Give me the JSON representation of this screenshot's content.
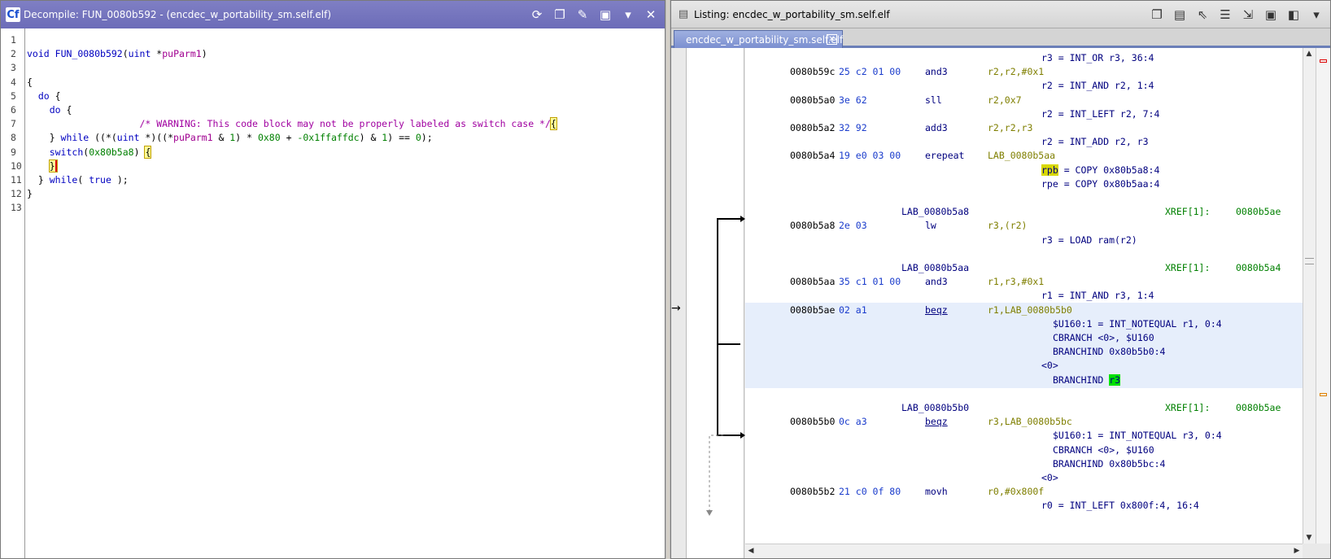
{
  "decompiler": {
    "app_icon": "Cf",
    "title": "Decompile: FUN_0080b592 -  (encdec_w_portability_sm.self.elf)",
    "icons": [
      "refresh-icon",
      "copy-icon",
      "edit-icon",
      "snapshot-icon",
      "menu-chevron-icon",
      "close-icon"
    ],
    "icon_glyphs": [
      "⟳",
      "❐",
      "✎",
      "▣",
      "▾",
      "✕"
    ],
    "lines": [
      {
        "n": "1",
        "code": ""
      },
      {
        "n": "2",
        "code": "void FUN_0080b592(uint *puParm1)"
      },
      {
        "n": "3",
        "code": ""
      },
      {
        "n": "4",
        "code": "{"
      },
      {
        "n": "5",
        "code": "  do {"
      },
      {
        "n": "6",
        "code": "    do {"
      },
      {
        "n": "7",
        "code": "                    /* WARNING: This code block may not be properly labeled as switch case */"
      },
      {
        "n": "8",
        "code": "    } while ((*(uint *)((*puParm1 & 1) * 0x80 + -0x1ffaffdc) & 1) == 0);"
      },
      {
        "n": "9",
        "code": "    switch(0x80b5a8) {"
      },
      {
        "n": "10",
        "code": "    }"
      },
      {
        "n": "11",
        "code": "  } while( true );"
      },
      {
        "n": "12",
        "code": "}"
      },
      {
        "n": "13",
        "code": ""
      }
    ]
  },
  "listing": {
    "title": "Listing: encdec_w_portability_sm.self.elf",
    "tab_label": "encdec_w_portability_sm.self.elf",
    "tab_close": "✕",
    "icons": [
      "copy-icon",
      "paste-icon",
      "select-cursor-icon",
      "columns-icon",
      "navigate-icon",
      "snapshot-icon",
      "layout-icon",
      "menu-chevron-icon"
    ],
    "icon_glyphs": [
      "❐",
      "▤",
      "⇖",
      "☰",
      "⇲",
      "▣",
      "◧",
      "▾"
    ],
    "rows": [
      {
        "pcode": "r3 = INT_OR r3, 36:4",
        "pcx": 364
      },
      {
        "addr": "0080b59c",
        "bytes": "25 c2 01 00",
        "mn": "and3",
        "ops": "r2,r2,#0x1"
      },
      {
        "pcode": "r2 = INT_AND r2, 1:4",
        "pcx": 364
      },
      {
        "addr": "0080b5a0",
        "bytes": "3e 62",
        "mn": "sll",
        "ops": "r2,0x7"
      },
      {
        "pcode": "r2 = INT_LEFT r2, 7:4",
        "pcx": 364
      },
      {
        "addr": "0080b5a2",
        "bytes": "32 92",
        "mn": "add3",
        "ops": "r2,r2,r3"
      },
      {
        "pcode": "r2 = INT_ADD r2, r3",
        "pcx": 364
      },
      {
        "addr": "0080b5a4",
        "bytes": "19 e0 03 00",
        "mn": "erepeat",
        "ops": "LAB_0080b5aa"
      },
      {
        "pcode": "rpb = COPY 0x80b5a8:4",
        "pcx": 364
      },
      {
        "pcode": "rpe = COPY 0x80b5aa:4",
        "pcx": 364
      },
      {},
      {
        "label": "LAB_0080b5a8",
        "xref": "XREF[1]:",
        "xaddr": "0080b5ae"
      },
      {
        "addr": "0080b5a8",
        "bytes": "2e 03",
        "mn": "lw",
        "ops": "r3,(r2)"
      },
      {
        "pcode": "r3 = LOAD ram(r2)",
        "pcx": 364
      },
      {},
      {
        "label": "LAB_0080b5aa",
        "xref": "XREF[1]:",
        "xaddr": "0080b5a4"
      },
      {
        "addr": "0080b5aa",
        "bytes": "35 c1 01 00",
        "mn": "and3",
        "ops": "r1,r3,#0x1"
      },
      {
        "pcode": "r1 = INT_AND r3, 1:4",
        "pcx": 364
      },
      {
        "addr": "0080b5ae",
        "bytes": "02 a1",
        "mn": "beqz",
        "ops": "r1,LAB_0080b5b0"
      },
      {
        "pcode": "$U160:1 = INT_NOTEQUAL r1, 0:4",
        "pcx": 378
      },
      {
        "pcode": "CBRANCH <0>, $U160",
        "pcx": 378
      },
      {
        "pcode": "BRANCHIND 0x80b5b0:4",
        "pcx": 378
      },
      {
        "pcode": "<0>",
        "pcx": 364
      },
      {
        "pcode": "BRANCHIND r3",
        "pcx": 378
      },
      {},
      {
        "label": "LAB_0080b5b0",
        "xref": "XREF[1]:",
        "xaddr": "0080b5ae"
      },
      {
        "addr": "0080b5b0",
        "bytes": "0c a3",
        "mn": "beqz",
        "ops": "r3,LAB_0080b5bc"
      },
      {
        "pcode": "$U160:1 = INT_NOTEQUAL r3, 0:4",
        "pcx": 378
      },
      {
        "pcode": "CBRANCH <0>, $U160",
        "pcx": 378
      },
      {
        "pcode": "BRANCHIND 0x80b5bc:4",
        "pcx": 378
      },
      {
        "pcode": "<0>",
        "pcx": 364
      },
      {
        "addr": "0080b5b2",
        "bytes": "21 c0 0f 80",
        "mn": "movh",
        "ops": "r0,#0x800f"
      },
      {
        "pcode": "r0 = INT_LEFT 0x800f:4, 16:4",
        "pcx": 364
      }
    ]
  },
  "colors": {
    "selection": "#e6eefb",
    "highlight_yellow": "#d8d800",
    "highlight_green": "#00e000"
  }
}
